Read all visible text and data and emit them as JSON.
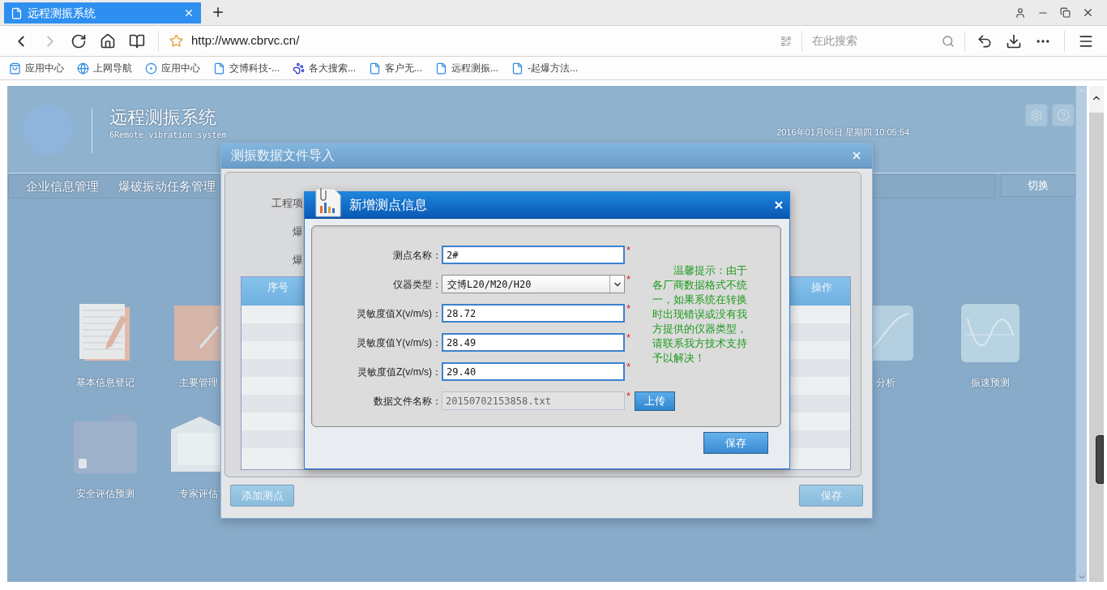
{
  "browser": {
    "tab": {
      "title": "远程测振系统"
    },
    "url": "http://www.cbrvc.cn/",
    "search": {
      "placeholder": "在此搜索"
    },
    "bookmarks": [
      {
        "kind": "bag",
        "label": "应用中心"
      },
      {
        "kind": "ie",
        "label": "上网导航"
      },
      {
        "kind": "ring",
        "label": "应用中心"
      },
      {
        "kind": "page",
        "label": "交博科技-..."
      },
      {
        "kind": "paw",
        "label": "各大搜索..."
      },
      {
        "kind": "page",
        "label": "客户无..."
      },
      {
        "kind": "page",
        "label": "远程测振..."
      },
      {
        "kind": "page",
        "label": "-起爆方法..."
      }
    ]
  },
  "page": {
    "title": "远程测振系统",
    "subtitle": "6Remote vibration system",
    "datetime": "2016年01月06日 星期四 10:05:54",
    "nav": [
      {
        "label": "企业信息管理"
      },
      {
        "label": "爆破振动任务管理"
      }
    ],
    "switch_button": "切换",
    "modules": [
      {
        "kind": "notebook",
        "label": "基本信息登记"
      },
      {
        "kind": "book",
        "label": "主要管理"
      },
      {
        "kind": "curve",
        "label": "分析"
      },
      {
        "kind": "wave",
        "label": "振速预测"
      },
      {
        "kind": "folder",
        "label": "安全评估预测"
      },
      {
        "kind": "letter",
        "label": "专家评估"
      }
    ]
  },
  "import_dialog": {
    "title": "测振数据文件导入",
    "labels": [
      "工程项",
      "爆",
      "爆"
    ],
    "table": {
      "columns": [
        "序号",
        "操作"
      ]
    },
    "buttons": [
      {
        "label": "添加测点"
      },
      {
        "label": "保存"
      }
    ]
  },
  "point_dialog": {
    "title": "新增测点信息",
    "fields": [
      {
        "kind": "text",
        "label": "测点名称：",
        "value": "2#",
        "marker": "*",
        "disabled": false
      },
      {
        "kind": "select",
        "label": "仪器类型：",
        "value": "交博L20/M20/H20",
        "marker": "*",
        "disabled": false
      },
      {
        "kind": "text",
        "label": "灵敏度值X(v/m/s)：",
        "value": "28.72",
        "marker": "*",
        "disabled": false
      },
      {
        "kind": "text",
        "label": "灵敏度值Y(v/m/s)：",
        "value": "28.49",
        "marker": "*",
        "disabled": false
      },
      {
        "kind": "text",
        "label": "灵敏度值Z(v/m/s)：",
        "value": "29.40",
        "marker": "*",
        "disabled": false
      },
      {
        "kind": "file",
        "label": "数据文件名称：",
        "value": "20150702153858.txt",
        "marker": "*",
        "disabled": true,
        "button": "上传"
      }
    ],
    "hint": "温馨提示：由于各厂商数据格式不统一，如果系统在转换时出现错误或没有我方提供的仪器类型，请联系我方技术支持予以解决！",
    "save": "保存"
  }
}
